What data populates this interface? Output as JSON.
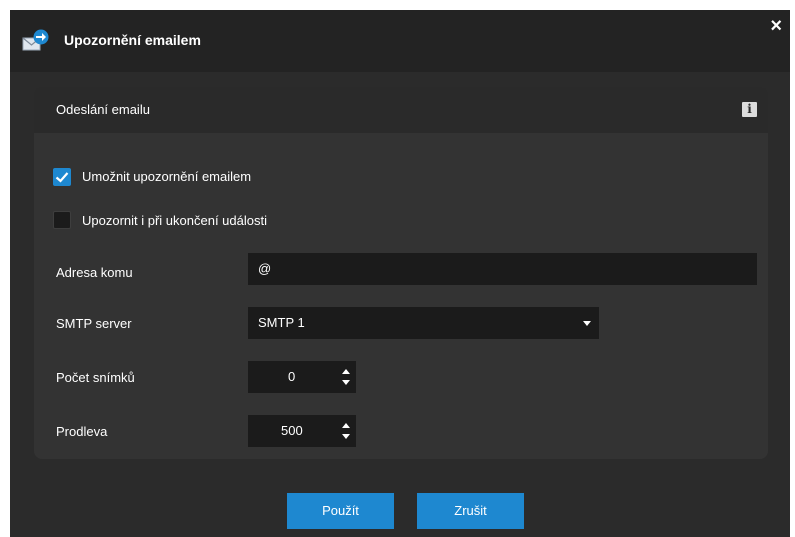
{
  "dialog": {
    "title": "Upozornění emailem",
    "close_label": "×"
  },
  "panel": {
    "title": "Odeslání emailu",
    "info_label": "i"
  },
  "options": {
    "enable_label": "Umožnit upozornění emailem",
    "enable_checked": true,
    "on_end_label": "Upozornit i při ukončení události",
    "on_end_checked": false
  },
  "fields": {
    "recipient_label": "Adresa komu",
    "recipient_value": "@",
    "smtp_label": "SMTP server",
    "smtp_value": "SMTP 1",
    "frames_label": "Počet snímků",
    "frames_value": "0",
    "delay_label": "Prodleva",
    "delay_value": "500"
  },
  "buttons": {
    "apply_label": "Použít",
    "cancel_label": "Zrušit"
  },
  "colors": {
    "accent": "#1e88d0",
    "background": "#2b2b2b",
    "panel": "#333333",
    "field": "#1b1b1b"
  }
}
